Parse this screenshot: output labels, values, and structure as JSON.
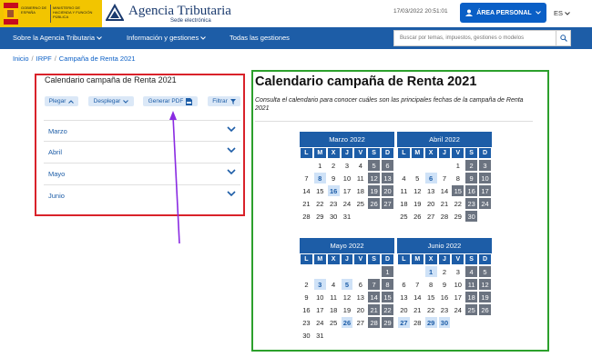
{
  "gov": {
    "block1": "Gobierno de España",
    "block2": "Ministerio de Hacienda y Función Pública",
    "flag_colors": [
      "#c60b1e",
      "#ffc400",
      "#c60b1e"
    ]
  },
  "brand": {
    "title": "Agencia Tributaria",
    "subtitle": "Sede electrónica",
    "color": "#1a3a6e"
  },
  "header": {
    "datetime": "17/03/2022 20:51:01",
    "area_label": "ÁREA PERSONAL",
    "lang": "ES"
  },
  "nav": {
    "items": [
      "Sobre la Agencia Tributaria",
      "Información y gestiones",
      "Todas las gestiones"
    ],
    "search_placeholder": "Buscar por temas, impuestos, gestiones o modelos",
    "color": "#1d5da7"
  },
  "breadcrumb": [
    "Inicio",
    "IRPF",
    "Campaña de Renta 2021"
  ],
  "panel": {
    "title": "Calendario campaña de Renta 2021",
    "buttons": [
      "Plegar",
      "Desplegar",
      "Generar PDF",
      "Filtrar"
    ],
    "months": [
      "Marzo",
      "Abril",
      "Mayo",
      "Junio"
    ]
  },
  "content": {
    "title": "Calendario campaña de Renta 2021",
    "intro": "Consulta el calendario para conocer cuáles son las principales fechas de la campaña de Renta 2021"
  },
  "weekdays": [
    "L",
    "M",
    "X",
    "J",
    "V",
    "S",
    "D"
  ],
  "calendars": [
    {
      "name": "Marzo 2022",
      "days": [
        "",
        "1",
        "2",
        "3",
        "4",
        "5",
        "6",
        "7",
        "8",
        "9",
        "10",
        "11",
        "12",
        "13",
        "14",
        "15",
        "16",
        "17",
        "18",
        "19",
        "20",
        "21",
        "22",
        "23",
        "24",
        "25",
        "26",
        "27",
        "28",
        "29",
        "30",
        "31",
        "",
        "",
        ""
      ],
      "holidays": [
        "5",
        "6",
        "12",
        "13",
        "19",
        "20",
        "26",
        "27"
      ],
      "marked": [
        "8",
        "16"
      ]
    },
    {
      "name": "Abril 2022",
      "days": [
        "",
        "",
        "",
        "",
        "1",
        "2",
        "3",
        "4",
        "5",
        "6",
        "7",
        "8",
        "9",
        "10",
        "11",
        "12",
        "13",
        "14",
        "15",
        "16",
        "17",
        "18",
        "19",
        "20",
        "21",
        "22",
        "23",
        "24",
        "25",
        "26",
        "27",
        "28",
        "29",
        "30",
        ""
      ],
      "holidays": [
        "2",
        "3",
        "9",
        "10",
        "15",
        "16",
        "17",
        "23",
        "24",
        "30"
      ],
      "marked": [
        "6"
      ]
    },
    {
      "name": "Mayo 2022",
      "days": [
        "",
        "",
        "",
        "",
        "",
        "",
        "1",
        "2",
        "3",
        "4",
        "5",
        "6",
        "7",
        "8",
        "9",
        "10",
        "11",
        "12",
        "13",
        "14",
        "15",
        "16",
        "17",
        "18",
        "19",
        "20",
        "21",
        "22",
        "23",
        "24",
        "25",
        "26",
        "27",
        "28",
        "29",
        "30",
        "31",
        "",
        "",
        "",
        "",
        ""
      ],
      "holidays": [
        "1",
        "7",
        "8",
        "14",
        "15",
        "21",
        "22",
        "28",
        "29"
      ],
      "marked": [
        "3",
        "5",
        "26"
      ]
    },
    {
      "name": "Junio 2022",
      "days": [
        "",
        "",
        "1",
        "2",
        "3",
        "4",
        "5",
        "6",
        "7",
        "8",
        "9",
        "10",
        "11",
        "12",
        "13",
        "14",
        "15",
        "16",
        "17",
        "18",
        "19",
        "20",
        "21",
        "22",
        "23",
        "24",
        "25",
        "26",
        "27",
        "28",
        "29",
        "30",
        "",
        "",
        ""
      ],
      "holidays": [
        "4",
        "5",
        "11",
        "12",
        "18",
        "19",
        "25",
        "26"
      ],
      "marked": [
        "1",
        "27",
        "29",
        "30"
      ]
    }
  ],
  "annotation_colors": {
    "red_box": "#d9222a",
    "green_box": "#2ca02c",
    "arrow": "#8a2be2"
  }
}
